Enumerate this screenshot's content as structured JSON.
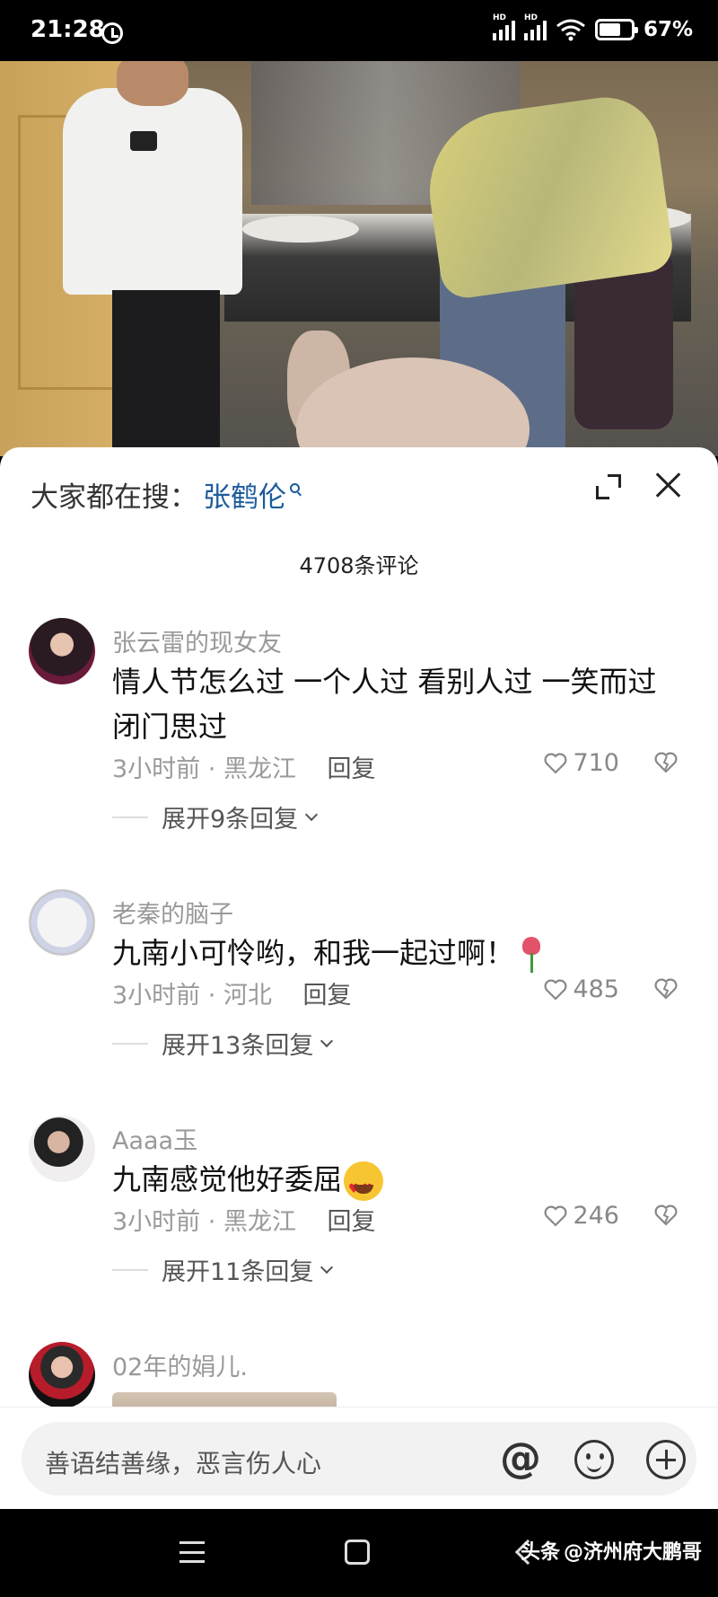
{
  "status_bar": {
    "time": "21:28",
    "signal1_label": "HD",
    "signal2_label": "HD",
    "battery_percent": "67%",
    "battery_level": 0.67
  },
  "sheet": {
    "hot_search_prefix": "大家都在搜：",
    "hot_search_term": "张鹤伦",
    "comment_count": "4708条评论"
  },
  "comments": [
    {
      "username": "张云雷的现女友",
      "content": "情人节怎么过 一个人过 看别人过 一笑而过 闭门思过",
      "time": "3小时前",
      "location": "黑龙江",
      "reply_label": "回复",
      "likes": "710",
      "expand_label": "展开9条回复"
    },
    {
      "username": "老秦的脑子",
      "content": "九南小可怜哟，和我一起过啊！",
      "emoji": "rose",
      "time": "3小时前",
      "location": "河北",
      "reply_label": "回复",
      "likes": "485",
      "expand_label": "展开13条回复"
    },
    {
      "username": "Aaaa玉",
      "content": "九南感觉他好委屈",
      "emoji": "heart-eyes",
      "time": "3小时前",
      "location": "黑龙江",
      "reply_label": "回复",
      "likes": "246",
      "expand_label": "展开11条回复"
    },
    {
      "username": "02年的娟儿."
    }
  ],
  "input": {
    "placeholder": "善语结善缘，恶言伤人心"
  },
  "watermark": {
    "logo": "头条",
    "handle": "@济州府大鹏哥"
  }
}
